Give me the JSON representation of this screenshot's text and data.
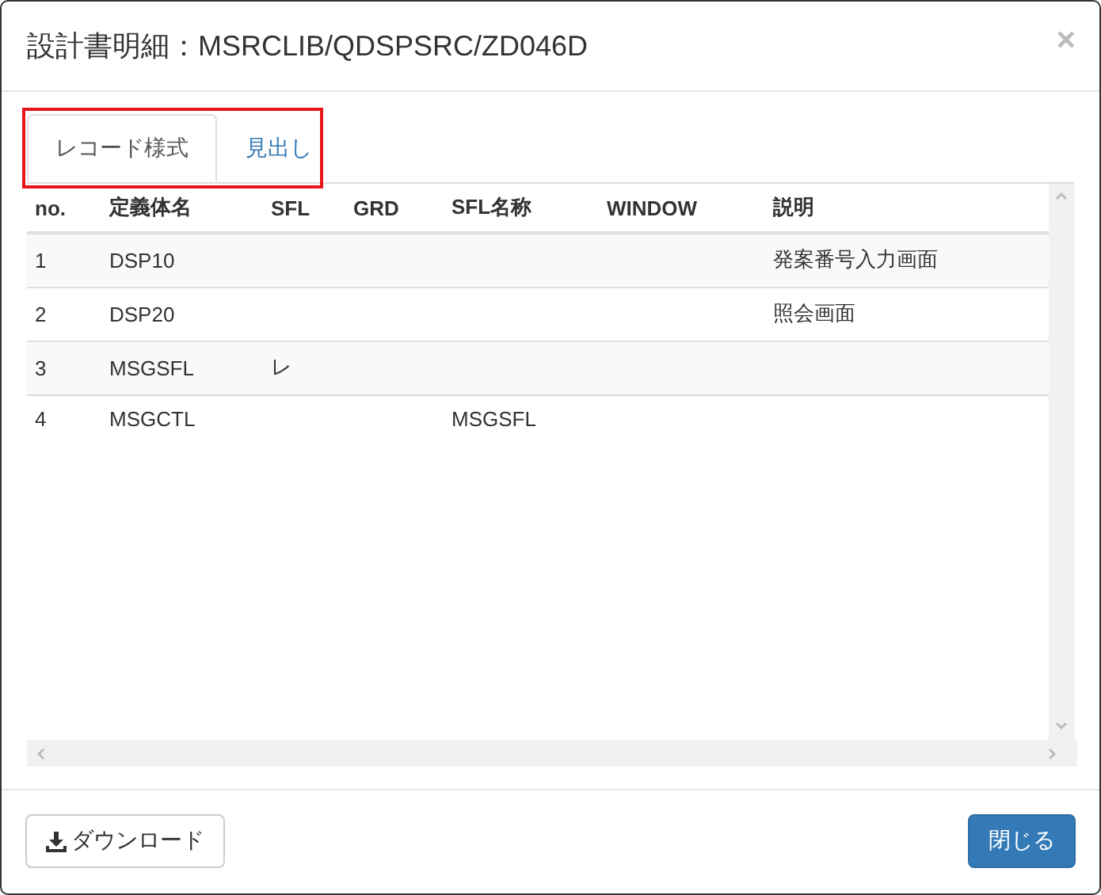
{
  "dialog": {
    "title": "設計書明細：MSRCLIB/QDSPSRC/ZD046D",
    "close": "×"
  },
  "tabs": [
    {
      "label": "レコード様式",
      "selected": true
    },
    {
      "label": "見出し",
      "selected": false
    }
  ],
  "table": {
    "columns": [
      "no.",
      "定義体名",
      "SFL",
      "GRD",
      "SFL名称",
      "WINDOW",
      "説明"
    ],
    "rows": [
      [
        "1",
        "DSP10",
        "",
        "",
        "",
        "",
        "発案番号入力画面"
      ],
      [
        "2",
        "DSP20",
        "",
        "",
        "",
        "",
        "照会画面"
      ],
      [
        "3",
        "MSGSFL",
        "レ",
        "",
        "",
        "",
        ""
      ],
      [
        "4",
        "MSGCTL",
        "",
        "",
        "MSGSFL",
        "",
        ""
      ]
    ]
  },
  "buttons": [
    {
      "label": "ダウンロード",
      "kind": "download"
    },
    {
      "label": "閉じる",
      "kind": "primary"
    }
  ]
}
